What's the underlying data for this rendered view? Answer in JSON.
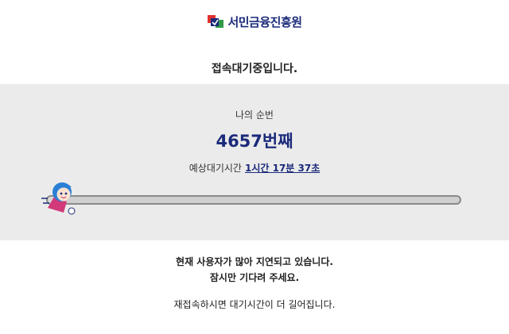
{
  "logo": {
    "text": "서민금융진흥원",
    "icon": "kinfa-logo-icon"
  },
  "headline": "접속대기중입니다.",
  "queue": {
    "rank_label": "나의 순번",
    "rank_value": "4657번째",
    "wait_label": "예상대기시간",
    "wait_time": "1시간 17분 37초",
    "progress_fraction": 0.02
  },
  "notice": {
    "line1": "현재 사용자가 많아 지연되고 있습니다.",
    "line2": "잠시만 기다려 주세요.",
    "line3": "재접속하시면 대기시간이 더 길어집니다."
  },
  "colors": {
    "brand_navy": "#1b2a7a",
    "panel_bg": "#ebebeb",
    "logo_red": "#e0322e",
    "logo_green": "#2f9b4a",
    "mascot_blue": "#2b7fd6",
    "mascot_pink": "#d23a7a"
  }
}
